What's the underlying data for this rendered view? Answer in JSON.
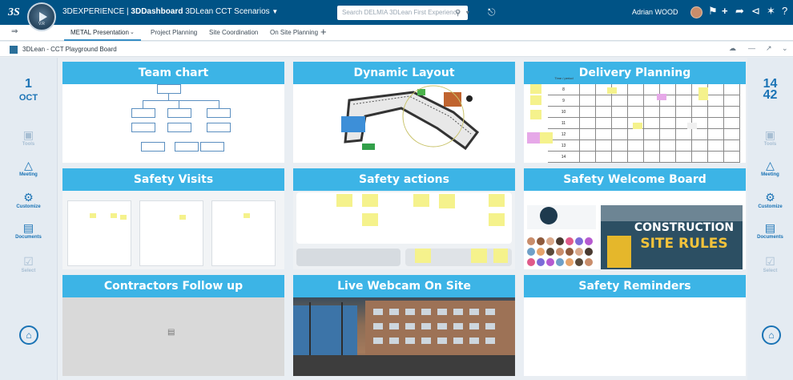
{
  "topbar": {
    "logo": "3S",
    "compass_version": "V.R",
    "title_prefix": "3DEXPERIENCE | ",
    "title_bold": "3DDashboard",
    "title_suffix": " 3DLean CCT Scenarios",
    "search_placeholder": "Search DELMIA 3DLean First Experience",
    "user_name": "Adrian WOOD"
  },
  "tabs": [
    {
      "label": "METAL Presentation",
      "active": true
    },
    {
      "label": "Project Planning",
      "active": false
    },
    {
      "label": "Site Coordination",
      "active": false
    },
    {
      "label": "On Site Planning",
      "active": false
    }
  ],
  "board": {
    "title": "3DLean - CCT Playground Board"
  },
  "left_panel": {
    "day": "1",
    "month": "OCT",
    "tools": [
      {
        "label": "Tools",
        "icon": "tshirt-icon"
      },
      {
        "label": "Meeting",
        "icon": "meeting-icon"
      },
      {
        "label": "Customize",
        "icon": "gear-icon"
      },
      {
        "label": "Documents",
        "icon": "document-icon"
      },
      {
        "label": "Select",
        "icon": "select-icon"
      }
    ]
  },
  "right_panel": {
    "hour": "14",
    "minute": "42",
    "tools": [
      {
        "label": "Tools",
        "icon": "tshirt-icon"
      },
      {
        "label": "Meeting",
        "icon": "meeting-icon"
      },
      {
        "label": "Customize",
        "icon": "gear-icon"
      },
      {
        "label": "Documents",
        "icon": "document-icon"
      },
      {
        "label": "Select",
        "icon": "select-icon"
      }
    ]
  },
  "tiles": [
    {
      "title": "Team chart"
    },
    {
      "title": "Dynamic Layout"
    },
    {
      "title": "Delivery Planning"
    },
    {
      "title": "Safety Visits"
    },
    {
      "title": "Safety actions"
    },
    {
      "title": "Safety Welcome Board"
    },
    {
      "title": "Contractors Follow up"
    },
    {
      "title": "Live Webcam On Site"
    },
    {
      "title": "Safety Reminders"
    }
  ],
  "delivery_planning": {
    "header_first": "Time / period",
    "rows": [
      "8",
      "9",
      "10",
      "11",
      "12",
      "13",
      "14"
    ]
  },
  "welcome_board": {
    "poster_line1": "CONSTRUCTION",
    "poster_line2": "SITE RULES"
  },
  "colors": {
    "topbar": "#005386",
    "tile_header": "#3cb4e6",
    "accent": "#1a73b5"
  }
}
